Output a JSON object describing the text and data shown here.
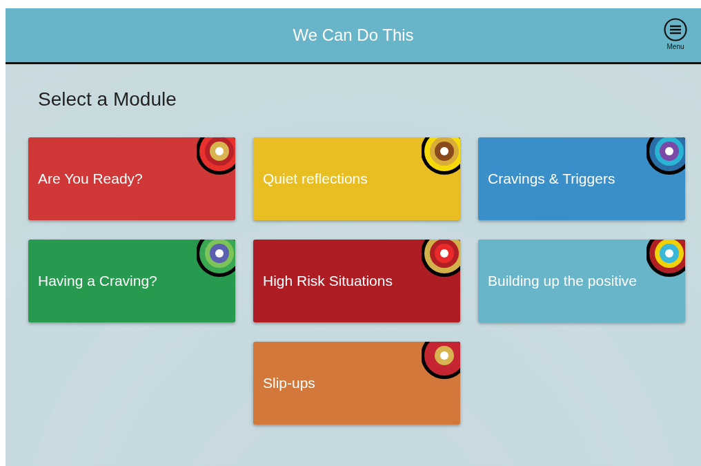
{
  "header": {
    "title": "We Can Do This",
    "menu_label": "Menu"
  },
  "heading": "Select a Module",
  "modules": [
    {
      "label": "Are You Ready?",
      "color": "#d03838"
    },
    {
      "label": "Quiet reflections",
      "color": "#e8be22"
    },
    {
      "label": "Cravings & Triggers",
      "color": "#3b8fc8"
    },
    {
      "label": "Having a Craving?",
      "color": "#279a4f"
    },
    {
      "label": "High Risk Situations",
      "color": "#ad1d23"
    },
    {
      "label": "Building up the positive",
      "color": "#68b5c9"
    },
    {
      "label": "Slip-ups",
      "color": "#d2783a"
    }
  ]
}
